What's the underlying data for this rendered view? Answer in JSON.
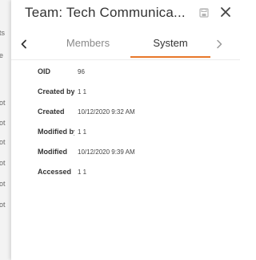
{
  "dialog": {
    "title": "Team: Tech Communica...",
    "icons": {
      "save": "save-disk-icon",
      "close": "close-icon"
    }
  },
  "tabs": {
    "items": [
      {
        "label": "Members",
        "active": false
      },
      {
        "label": "System",
        "active": true
      }
    ],
    "accent_color": "#e8782a"
  },
  "system_fields": [
    {
      "label": "OID",
      "value": "96"
    },
    {
      "label": "Created by",
      "value": "1 1"
    },
    {
      "label": "Created",
      "value": "10/12/2020 9:32 AM"
    },
    {
      "label": "Modified by",
      "value": "1 1"
    },
    {
      "label": "Modified",
      "value": "10/12/2020 9:39 AM"
    },
    {
      "label": "Accessed",
      "value": "1 1"
    }
  ],
  "background_strip": {
    "fragments": [
      "ts",
      "e",
      "ot",
      "ot",
      "ot",
      "ot",
      "ot",
      "ot"
    ]
  }
}
